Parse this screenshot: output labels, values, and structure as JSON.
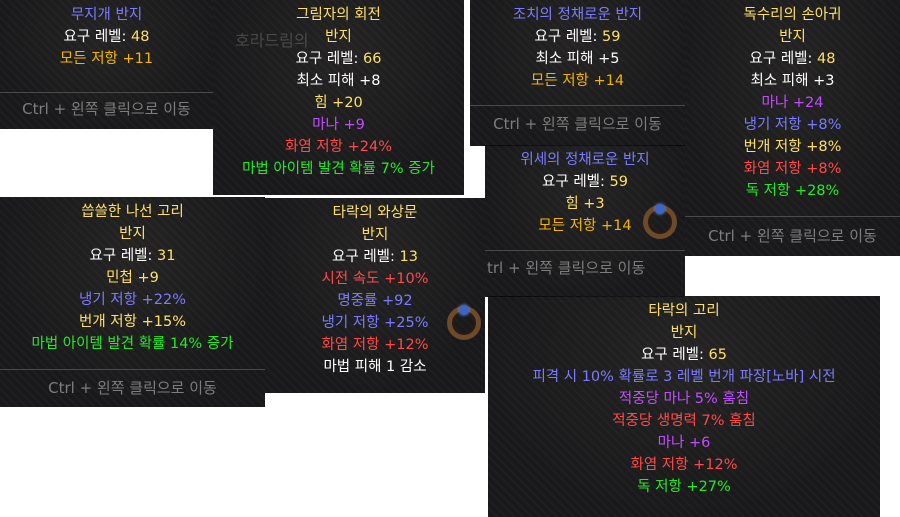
{
  "tooltips": {
    "rainbow": {
      "name": "무지개 반지",
      "lines": [
        {
          "label": "요구 레벨: ",
          "value": "48"
        },
        {
          "label": "모든 저항 +11"
        }
      ],
      "ctrl": "Ctrl + 왼쪽 클릭으로 이동"
    },
    "shadow": {
      "name": "그림자의 회전",
      "type": "반지",
      "lines": [
        {
          "label": "요구 레벨: ",
          "value": "66"
        },
        {
          "label": "최소 피해 +8"
        },
        {
          "label": "힘 +20"
        },
        {
          "label": "마나 +9"
        },
        {
          "label": "화염 저항 +24%"
        },
        {
          "label": "마법 아이템 발견 확률 7% 증가"
        }
      ],
      "ghost": "호라드림의"
    },
    "chosi": {
      "name": "조치의 정채로운 반지",
      "lines": [
        {
          "label": "요구 레벨: ",
          "value": "59"
        },
        {
          "label": "최소 피해 +5"
        },
        {
          "label": "모든 저항 +14"
        }
      ],
      "ctrl": "Ctrl + 왼쪽 클릭으로 이동"
    },
    "eagle": {
      "name": "독수리의 손아귀",
      "type": "반지",
      "lines": [
        {
          "label": "요구 레벨: ",
          "value": "48"
        },
        {
          "label": "최소 피해 +3"
        },
        {
          "label": "마나 +24"
        },
        {
          "label": "냉기 저항 +8%"
        },
        {
          "label": "번개 저항 +8%"
        },
        {
          "label": "화염 저항 +8%"
        },
        {
          "label": "독 저항 +28%"
        }
      ],
      "ctrl": "Ctrl + 왼쪽 클릭으로 이동"
    },
    "wise": {
      "name": "위세의 정채로운 반지",
      "lines": [
        {
          "label": "요구 레벨: ",
          "value": "59"
        },
        {
          "label": "힘 +3"
        },
        {
          "label": "모든 저항 +14"
        }
      ],
      "ctrl": "trl + 왼쪽 클릭으로 이동"
    },
    "bitter": {
      "name": "씁쓸한 나선 고리",
      "type": "반지",
      "lines": [
        {
          "label": "요구 레벨: ",
          "value": "31"
        },
        {
          "label": "민첩 +9"
        },
        {
          "label": "냉기 저항 +22%"
        },
        {
          "label": "번개 저항 +15%"
        },
        {
          "label": "마법 아이템 발견 확률 14% 증가"
        }
      ],
      "ctrl": "Ctrl + 왼쪽 클릭으로 이동"
    },
    "corrupt_moan": {
      "name": "타락의 와상문",
      "type": "반지",
      "lines": [
        {
          "label": "요구 레벨: ",
          "value": "13"
        },
        {
          "label": "시전 속도 +10%"
        },
        {
          "label": "명중률 +92"
        },
        {
          "label": "냉기 저항 +25%"
        },
        {
          "label": "화염 저항 +12%"
        },
        {
          "label": "마법 피해 1 감소"
        }
      ]
    },
    "corrupt_ring": {
      "name": "타락의 고리",
      "type": "반지",
      "lines": [
        {
          "label": "요구 레벨: ",
          "value": "65"
        },
        {
          "label": "피격 시 10% 확률로 3 레벨 번개 파장[노바] 시전"
        },
        {
          "label": "적중당 마나 5% 훔침"
        },
        {
          "label": "적중당 생명력 7% 훔침"
        },
        {
          "label": "마나 +6"
        },
        {
          "label": "화염 저항 +12%"
        },
        {
          "label": "독 저항 +27%"
        }
      ]
    }
  },
  "colors": {
    "magic_name": "#7b7bff",
    "rare_name": "#ffe066",
    "fire": "#ff4a4a",
    "cold": "#7b7bff",
    "lightning": "#ffe066",
    "poison": "#27e827",
    "mana": "#c24dff",
    "all_res": "#f5b400",
    "magic_find": "#27e827",
    "ctrl_text": "#7d7d7d"
  }
}
